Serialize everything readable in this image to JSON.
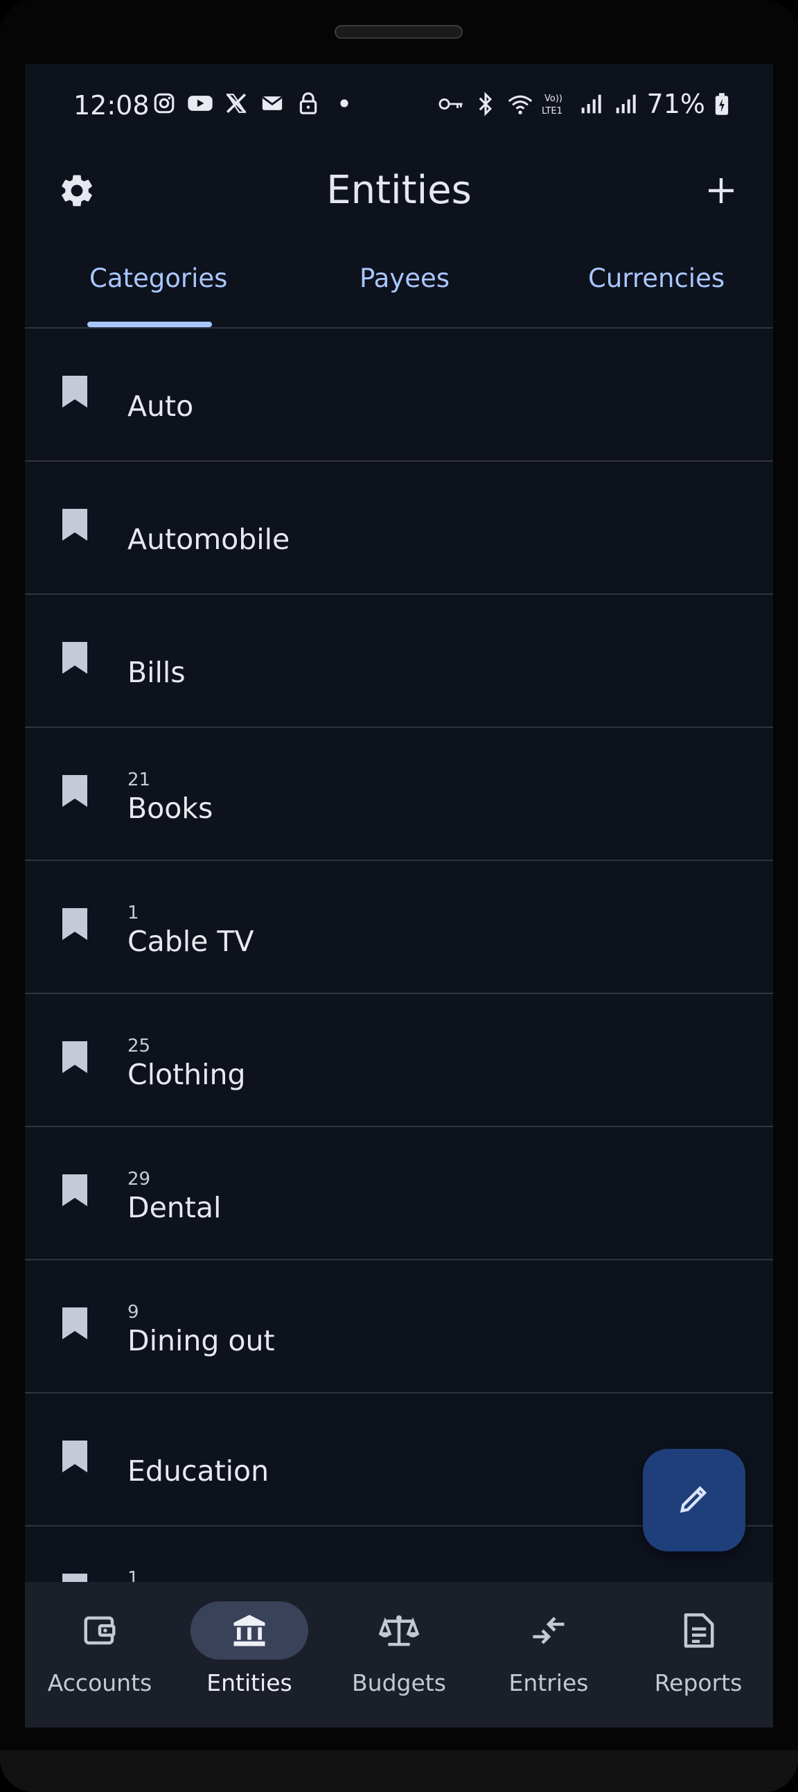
{
  "status_bar": {
    "time": "12:08",
    "left_icons": [
      "instagram-icon",
      "youtube-icon",
      "x-icon",
      "mail-icon",
      "lock-icon",
      "dot-icon"
    ],
    "right_icons": [
      "key-icon",
      "bluetooth-icon",
      "wifi-icon",
      "volte-icon",
      "signal-icon",
      "signal-icon",
      "battery-charging-icon"
    ],
    "volte_text": "Vo))\nLTE1",
    "battery": "71%"
  },
  "app_bar": {
    "title": "Entities",
    "left_icon": "gear-icon",
    "right_icon": "plus-icon"
  },
  "tabs": [
    {
      "label": "Categories",
      "active": true
    },
    {
      "label": "Payees",
      "active": false
    },
    {
      "label": "Currencies",
      "active": false
    }
  ],
  "categories": [
    {
      "count": "",
      "name": "Auto"
    },
    {
      "count": "",
      "name": "Automobile"
    },
    {
      "count": "",
      "name": "Bills"
    },
    {
      "count": "21",
      "name": "Books"
    },
    {
      "count": "1",
      "name": "Cable TV"
    },
    {
      "count": "25",
      "name": "Clothing"
    },
    {
      "count": "29",
      "name": "Dental"
    },
    {
      "count": "9",
      "name": "Dining out"
    },
    {
      "count": "",
      "name": "Education"
    },
    {
      "count": "1",
      "name": ""
    }
  ],
  "fab": {
    "icon": "pencil-icon"
  },
  "bottom_nav": [
    {
      "label": "Accounts",
      "icon": "wallet-icon",
      "active": false
    },
    {
      "label": "Entities",
      "icon": "bank-icon",
      "active": true
    },
    {
      "label": "Budgets",
      "icon": "scale-icon",
      "active": false
    },
    {
      "label": "Entries",
      "icon": "transfer-arrows-icon",
      "active": false
    },
    {
      "label": "Reports",
      "icon": "document-icon",
      "active": false
    }
  ],
  "colors": {
    "background": "#0e121d",
    "accent": "#a9c7ff",
    "fab": "#1e3f7a",
    "nav_active": "#3a4259",
    "bottom_nav": "#1b1f2a"
  }
}
